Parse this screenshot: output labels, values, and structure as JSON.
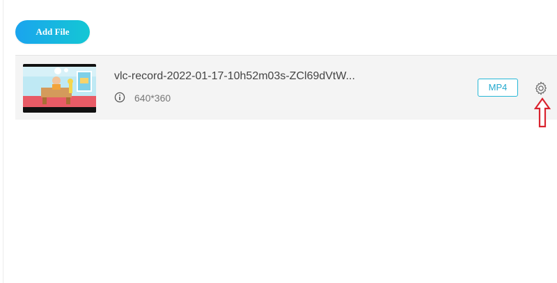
{
  "toolbar": {
    "add_file_label": "Add File"
  },
  "file_list": {
    "items": [
      {
        "name": "vlc-record-2022-01-17-10h52m03s-ZCl69dVtW...",
        "resolution": "640*360",
        "format": "MP4",
        "icons": {
          "info": "info-icon",
          "settings": "gear-icon"
        }
      }
    ]
  },
  "colors": {
    "accent_start": "#1aa4ee",
    "accent_end": "#14c7d4",
    "format_border": "#24b6d6",
    "annotation_arrow": "#d9232e"
  }
}
